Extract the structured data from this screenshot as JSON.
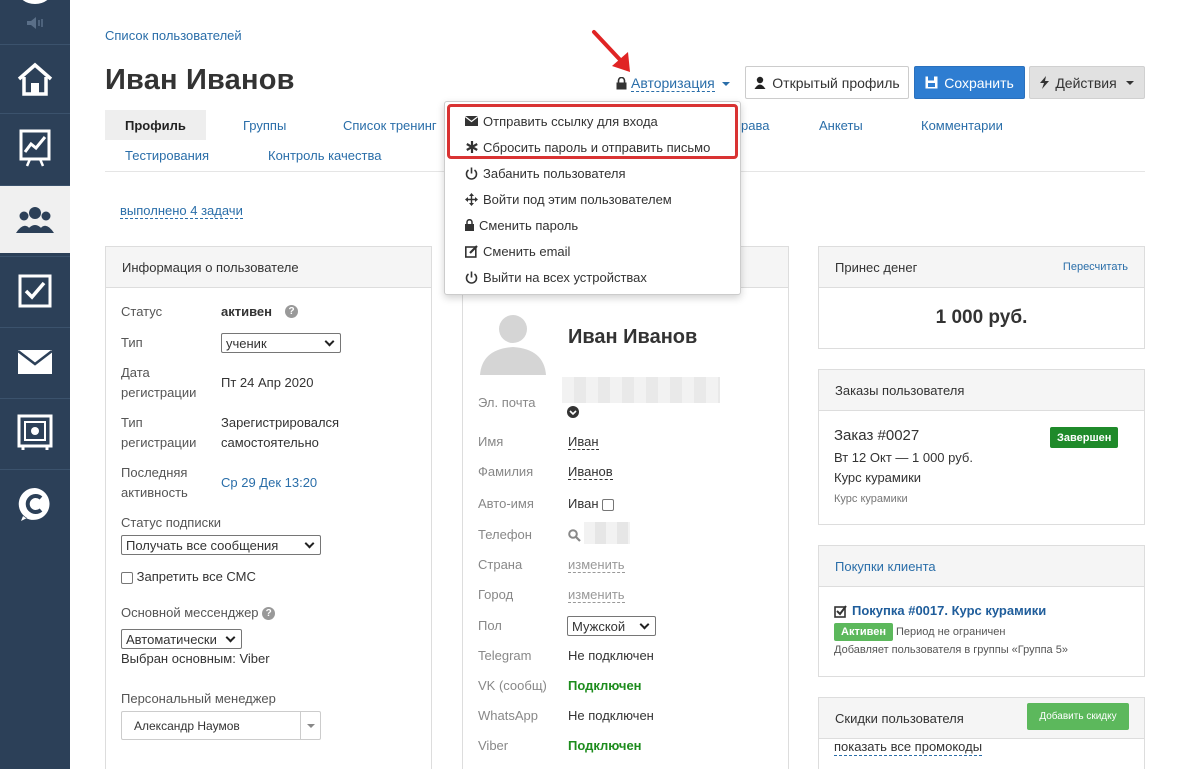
{
  "breadcrumb": "Список пользователей",
  "page_title": "Иван Иванов",
  "header": {
    "auth_label": "Авторизация",
    "open_profile_label": "Открытый профиль",
    "save_label": "Сохранить",
    "actions_label": "Действия"
  },
  "tabs": {
    "profile": "Профиль",
    "groups": "Группы",
    "trainings": "Список тренинг",
    "rights": "рава",
    "forms": "Анкеты",
    "comments": "Комментарии",
    "tests": "Тестирования",
    "quality": "Контроль качества"
  },
  "tasks_link": "выполнено 4 задачи",
  "dropdown": {
    "items": [
      "Отправить ссылку для входа",
      "Сбросить пароль и отправить письмо",
      "Забанить пользователя",
      "Войти под этим пользователем",
      "Сменить пароль",
      "Сменить email",
      "Выйти на всех устройствах"
    ]
  },
  "user_info": {
    "title": "Информация о пользователе",
    "status_label": "Статус",
    "status_value": "активен",
    "type_label": "Тип",
    "type_value": "ученик",
    "reg_date_label_1": "Дата",
    "reg_date_label_2": "регистрации",
    "reg_date_value": "Пт 24 Апр 2020",
    "reg_type_label_1": "Тип",
    "reg_type_label_2": "регистрации",
    "reg_type_value_1": "Зарегистрировался",
    "reg_type_value_2": "самостоятельно",
    "last_active_label_1": "Последняя",
    "last_active_label_2": "активность",
    "last_active_value": "Ср 29 Дек 13:20",
    "subscription_label": "Статус подписки",
    "subscription_value": "Получать все сообщения",
    "sms_label": "Запретить все СМС",
    "messenger_label": "Основной мессенджер",
    "messenger_value": "Автоматически",
    "messenger_chosen": "Выбран основным: Viber",
    "manager_label": "Персональный менеджер",
    "manager_value": "Александр Наумов"
  },
  "profile_card": {
    "name": "Иван Иванов",
    "email_label": "Эл. почта",
    "first_name_label": "Имя",
    "first_name_value": "Иван",
    "last_name_label": "Фамилия",
    "last_name_value": "Иванов",
    "autoname_label": "Авто-имя",
    "autoname_value": "Иван",
    "phone_label": "Телефон",
    "country_label": "Страна",
    "country_value": "изменить",
    "city_label": "Город",
    "city_value": "изменить",
    "gender_label": "Пол",
    "gender_value": "Мужской",
    "telegram_label": "Telegram",
    "telegram_value": "Не подключен",
    "vk_label": "VK (сообщ)",
    "vk_value": "Подключен",
    "whatsapp_label": "WhatsApp",
    "whatsapp_value": "Не подключен",
    "viber_label": "Viber",
    "viber_value": "Подключен"
  },
  "money": {
    "title": "Принес денег",
    "recalc": "Пересчитать",
    "amount": "1 000 руб."
  },
  "orders": {
    "title": "Заказы пользователя",
    "order_link": "Заказ #0027",
    "order_status": "Завершен",
    "order_meta": "Вт 12 Окт — 1 000 руб.",
    "order_product": "Курс курамики",
    "order_product_small": "Курс курамики"
  },
  "purchases": {
    "title": "Покупки клиента",
    "purchase_link": "Покупка #0017. Курс курамики",
    "purchase_status": "Активен",
    "purchase_period": "Период не ограничен",
    "purchase_groups": "Добавляет пользователя в группы «Группа 5»"
  },
  "discounts": {
    "title": "Скидки пользователя",
    "add_button": "Добавить скидку",
    "promo_link": "показать все промокоды"
  },
  "colors": {
    "sidebar": "#2c4058",
    "link": "#2a6ea9",
    "primary_button": "#2e7dd1",
    "highlight": "#d93333",
    "badge_done": "#1f8a2a",
    "badge_active": "#5cb85c",
    "add_discount": "#5cb85c"
  }
}
